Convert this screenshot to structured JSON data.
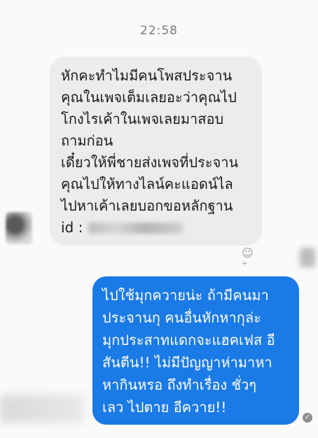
{
  "chat": {
    "timestamp": "22:58",
    "incoming": {
      "lines": [
        "หักคะทำไมมีคนโพสประจาน",
        "คุณในเพจเต็มเลยอะว่าคุณไป",
        "โกงไรเค้าในเพจเลยมาสอบ",
        "ถามก่อน",
        "เดี๋ยวให้พี่ชายส่งเพจที่ประจาน",
        "คุณไปให้ทางไลน์คะแอดน์ไล",
        "ไปหาเค้าเลยบอกขอหลักฐาน"
      ],
      "id_label": "id :"
    },
    "outgoing": {
      "lines": [
        "ไปใช้มุกควายน่ะ ถ้ามีคนมา",
        "ประจานกุ คนอื่นหักหากุล่ะ",
        "มุกประสาทแดกจะแฮคเฟส อี",
        "สันตีน!! ไม่มีปัญญาห่ามาหา",
        "หากินหรอ ถึงทำเรื่อง ชั่วๆ",
        "เลว ไปตาย อีควาย!!"
      ]
    },
    "icons": {
      "react": "add-reaction-icon",
      "seen": "seen-check-icon"
    },
    "colors": {
      "incoming_bubble": "#ececec",
      "outgoing_bubble": "#1a7ae6"
    }
  }
}
